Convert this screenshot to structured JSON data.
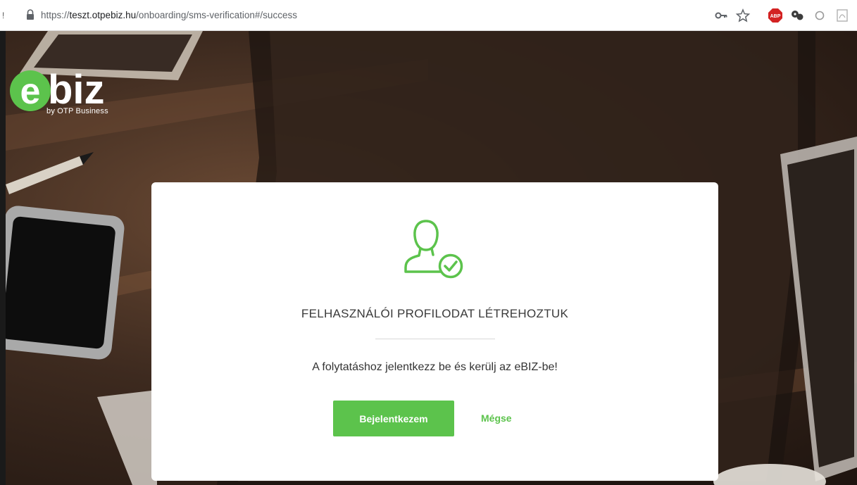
{
  "browser": {
    "url_prefix": "https://",
    "url_host": "teszt.otpebiz.hu",
    "url_path": "/onboarding/sms-verification#/success",
    "left_marker": "!"
  },
  "logo": {
    "brand": "ebiz",
    "tagline": "by OTP Business"
  },
  "modal": {
    "title": "FELHASZNÁLÓI PROFILODAT LÉTREHOZTUK",
    "message": "A folytatáshoz jelentkezz be és kerülj az eBIZ-be!",
    "login_label": "Bejelentkezem",
    "cancel_label": "Mégse"
  },
  "colors": {
    "accent": "#5cc34c",
    "title_text": "#3a3a3a"
  },
  "icons": [
    "lock-icon",
    "key-icon",
    "star-icon",
    "adblock-icon",
    "extension-icon",
    "circle-extension-icon",
    "pdf-icon",
    "user-check-icon"
  ]
}
